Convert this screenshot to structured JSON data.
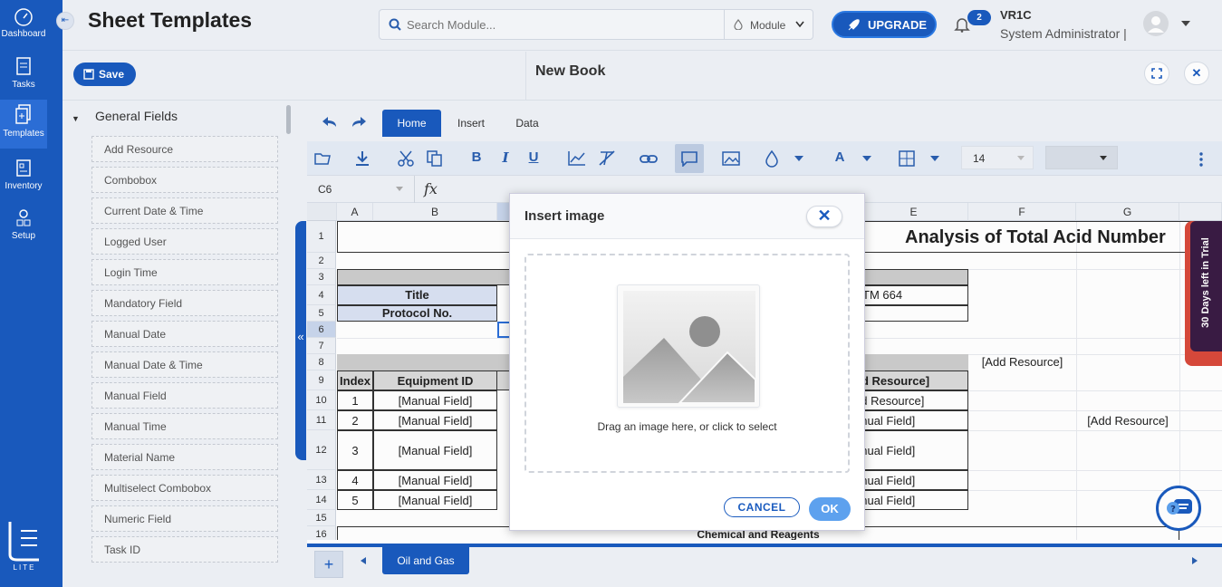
{
  "nav": {
    "items": [
      {
        "label": "Dashboard",
        "icon": "dashboard-icon"
      },
      {
        "label": "Tasks",
        "icon": "tasks-icon"
      },
      {
        "label": "Templates",
        "icon": "templates-icon"
      },
      {
        "label": "Inventory",
        "icon": "inventory-icon"
      },
      {
        "label": "Setup",
        "icon": "setup-icon"
      }
    ],
    "logo_text": "LITE"
  },
  "header": {
    "title": "Sheet Templates",
    "search_placeholder": "Search Module...",
    "module_label": "Module",
    "upgrade_label": "UPGRADE",
    "notification_count": "2",
    "user_name": "VR1C",
    "user_role": "System Administrator |"
  },
  "subbar": {
    "save_label": "Save",
    "book_title": "New Book"
  },
  "fields_panel": {
    "heading": "General Fields",
    "items": [
      "Add Resource",
      "Combobox",
      "Current Date & Time",
      "Logged User",
      "Login Time",
      "Mandatory Field",
      "Manual Date",
      "Manual Date & Time",
      "Manual Field",
      "Manual Time",
      "Material Name",
      "Multiselect Combobox",
      "Numeric Field",
      "Task ID"
    ]
  },
  "sheet": {
    "tabs": [
      "Home",
      "Insert",
      "Data"
    ],
    "active_tab": "Home",
    "font_size": "14",
    "cell_ref": "C6",
    "columns": [
      "A",
      "B",
      "",
      "",
      "E",
      "F",
      "G"
    ],
    "rows": [
      "1",
      "2",
      "3",
      "4",
      "5",
      "6",
      "7",
      "8",
      "9",
      "10",
      "11",
      "12",
      "13",
      "14",
      "15",
      "16"
    ],
    "cells": {
      "title": "Analysis of Total Acid Number",
      "title_label": "Title",
      "protocol_label": "Protocol No.",
      "method": "TM 664",
      "header_index": "Index",
      "header_equipment": "Equipment ID",
      "header_resource": "dd Resource]",
      "r8_f": "[Add Resource]",
      "r10_e": "dd Resource]",
      "r11_g": "[Add Resource]",
      "manual": "[Manual Field]",
      "manual_partial": "anual Field]",
      "indexes": [
        "1",
        "2",
        "3",
        "4",
        "5"
      ],
      "chemical": "Chemical and Reagents"
    },
    "sheet_tab": "Oil and Gas"
  },
  "trial_banner": "30 Days left in Trial",
  "modal": {
    "title": "Insert image",
    "dropzone_text": "Drag an image here, or click to select",
    "cancel_label": "CANCEL",
    "ok_label": "OK"
  }
}
